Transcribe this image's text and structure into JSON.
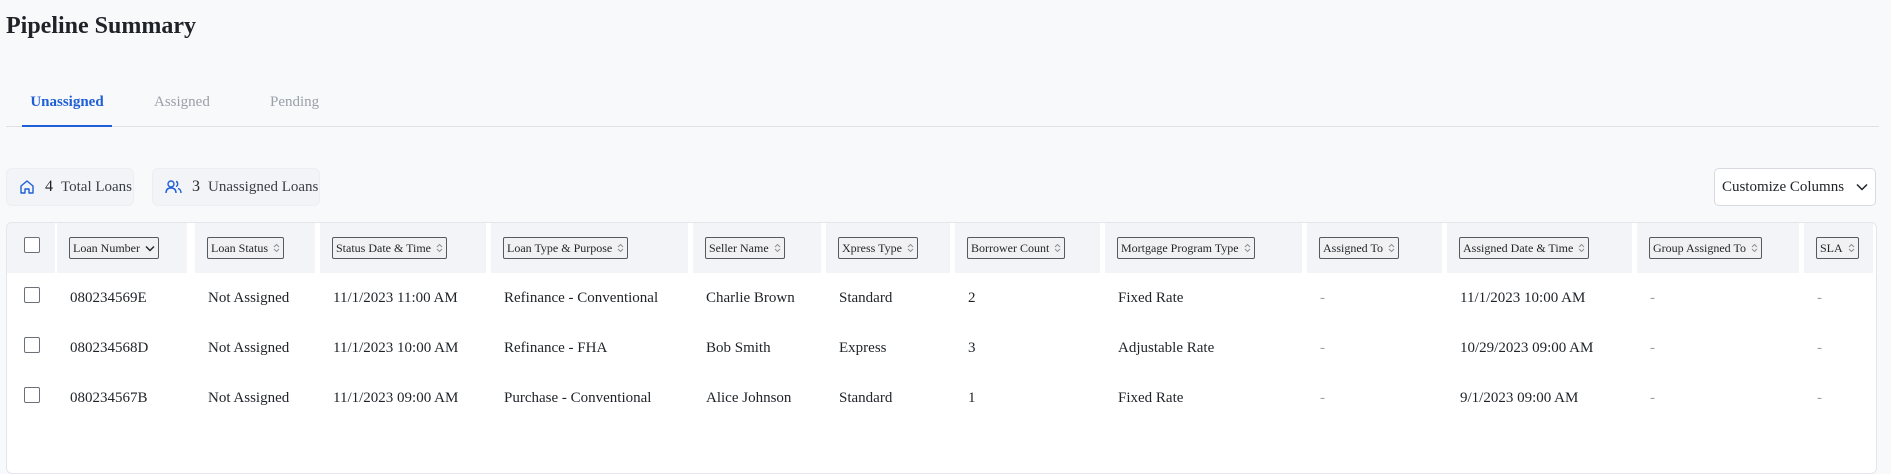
{
  "page": {
    "title": "Pipeline Summary"
  },
  "tabs": [
    {
      "label": "Unassigned",
      "active": true
    },
    {
      "label": "Assigned",
      "active": false
    },
    {
      "label": "Pending",
      "active": false
    }
  ],
  "stats": {
    "total": {
      "count": "4",
      "label": "Total Loans",
      "icon": "home-icon"
    },
    "unassigned": {
      "count": "3",
      "label": "Unassigned Loans",
      "icon": "users-icon"
    }
  },
  "customize_columns": {
    "label": "Customize Columns",
    "icon": "chevron-down-icon"
  },
  "table": {
    "columns": [
      {
        "key": "loan_number",
        "label": "Loan Number",
        "sort_icon": "chevron-down-icon"
      },
      {
        "key": "loan_status",
        "label": "Loan Status",
        "sort_icon": "sort-icon"
      },
      {
        "key": "status_datetime",
        "label": "Status Date & Time",
        "sort_icon": "sort-icon"
      },
      {
        "key": "loan_type",
        "label": "Loan Type & Purpose",
        "sort_icon": "sort-icon"
      },
      {
        "key": "seller_name",
        "label": "Seller Name",
        "sort_icon": "sort-icon"
      },
      {
        "key": "xpress_type",
        "label": "Xpress Type",
        "sort_icon": "sort-icon"
      },
      {
        "key": "borrower_count",
        "label": "Borrower Count",
        "sort_icon": "sort-icon"
      },
      {
        "key": "mortgage_program",
        "label": "Mortgage Program Type",
        "sort_icon": "sort-icon"
      },
      {
        "key": "assigned_to",
        "label": "Assigned To",
        "sort_icon": "sort-icon"
      },
      {
        "key": "assigned_datetime",
        "label": "Assigned Date & Time",
        "sort_icon": "sort-icon"
      },
      {
        "key": "group_assigned_to",
        "label": "Group Assigned To",
        "sort_icon": "sort-icon"
      },
      {
        "key": "sla",
        "label": "SLA",
        "sort_icon": "sort-icon"
      }
    ],
    "rows": [
      [
        "080234569E",
        "Not Assigned",
        "11/1/2023 11:00 AM",
        "Refinance - Conventional",
        "Charlie Brown",
        "Standard",
        "2",
        "Fixed Rate",
        "-",
        "11/1/2023 10:00 AM",
        "-",
        "-"
      ],
      [
        "080234568D",
        "Not Assigned",
        "11/1/2023 10:00 AM",
        "Refinance - FHA",
        "Bob Smith",
        "Express",
        "3",
        "Adjustable Rate",
        "-",
        "10/29/2023 09:00 AM",
        "-",
        "-"
      ],
      [
        "080234567B",
        "Not Assigned",
        "11/1/2023 09:00 AM",
        "Purchase - Conventional",
        "Alice Johnson",
        "Standard",
        "1",
        "Fixed Rate",
        "-",
        "9/1/2023 09:00 AM",
        "-",
        "-"
      ]
    ]
  },
  "colors": {
    "accent": "#1f5fd6",
    "muted_text": "#9aa0a8",
    "header_bg": "#f3f4f7",
    "page_bg": "#f8f9fb"
  }
}
